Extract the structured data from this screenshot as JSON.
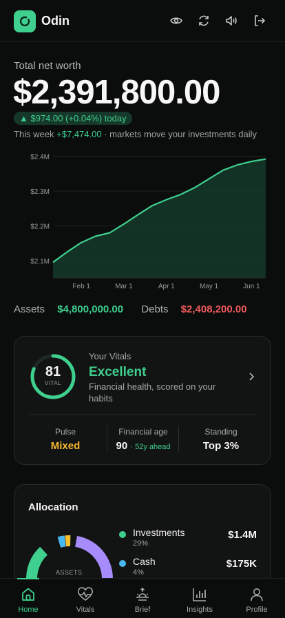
{
  "app": {
    "name": "Odin"
  },
  "header": {
    "icons": [
      "eye-icon",
      "refresh-icon",
      "speaker-icon",
      "logout-icon"
    ]
  },
  "net_worth": {
    "label": "Total net worth",
    "value": "$2,391,800.00",
    "today_change": "▲ $974.00 (+0.04%) today",
    "week_prefix": "This week",
    "week_change": "+$7,474.00",
    "week_suffix": "· markets move your investments daily"
  },
  "chart_data": {
    "type": "area",
    "x": [
      "Jan 15",
      "Jan 22",
      "Feb 1",
      "Feb 10",
      "Feb 20",
      "Mar 1",
      "Mar 10",
      "Mar 20",
      "Apr 1",
      "Apr 10",
      "Apr 20",
      "May 1",
      "May 10",
      "May 20",
      "Jun 1",
      "Jun 8"
    ],
    "values": [
      2.095,
      2.125,
      2.152,
      2.17,
      2.18,
      2.205,
      2.232,
      2.258,
      2.275,
      2.29,
      2.31,
      2.335,
      2.36,
      2.375,
      2.385,
      2.392
    ],
    "y_unit": "$M",
    "y_ticks": [
      "$2.4M",
      "$2.3M",
      "$2.2M",
      "$2.1M"
    ],
    "x_ticks": [
      "Feb 1",
      "Mar 1",
      "Apr 1",
      "May 1",
      "Jun 1"
    ],
    "ylim": [
      2.05,
      2.405
    ],
    "grid": true,
    "line_color": "#3fcf8e"
  },
  "summary": {
    "assets_label": "Assets",
    "assets_value": "$4,800,000.00",
    "debts_label": "Debts",
    "debts_value": "$2,408,200.00"
  },
  "vitals": {
    "score": "81",
    "score_fraction": 0.81,
    "score_label": "VITAL",
    "eyebrow": "Your Vitals",
    "status": "Excellent",
    "description": "Financial health, scored on your habits",
    "stats": [
      {
        "label": "Pulse",
        "value": "Mixed",
        "extra": ""
      },
      {
        "label": "Financial age",
        "value": "90",
        "extra": "· 52y ahead"
      },
      {
        "label": "Standing",
        "value": "Top 3%",
        "extra": ""
      }
    ]
  },
  "allocation": {
    "title": "Allocation",
    "center_label": "ASSETS",
    "items": [
      {
        "name": "Investments",
        "pct": "29%",
        "value": "$1.4M",
        "color": "#3fcf8e"
      },
      {
        "name": "Cash",
        "pct": "4%",
        "value": "$175K",
        "color": "#4ab8f0"
      }
    ]
  },
  "tabs": [
    {
      "label": "Home",
      "icon": "home-icon",
      "active": true
    },
    {
      "label": "Vitals",
      "icon": "heart-pulse-icon",
      "active": false
    },
    {
      "label": "Brief",
      "icon": "sunrise-icon",
      "active": false
    },
    {
      "label": "Insights",
      "icon": "bar-chart-icon",
      "active": false
    },
    {
      "label": "Profile",
      "icon": "user-icon",
      "active": false
    }
  ]
}
